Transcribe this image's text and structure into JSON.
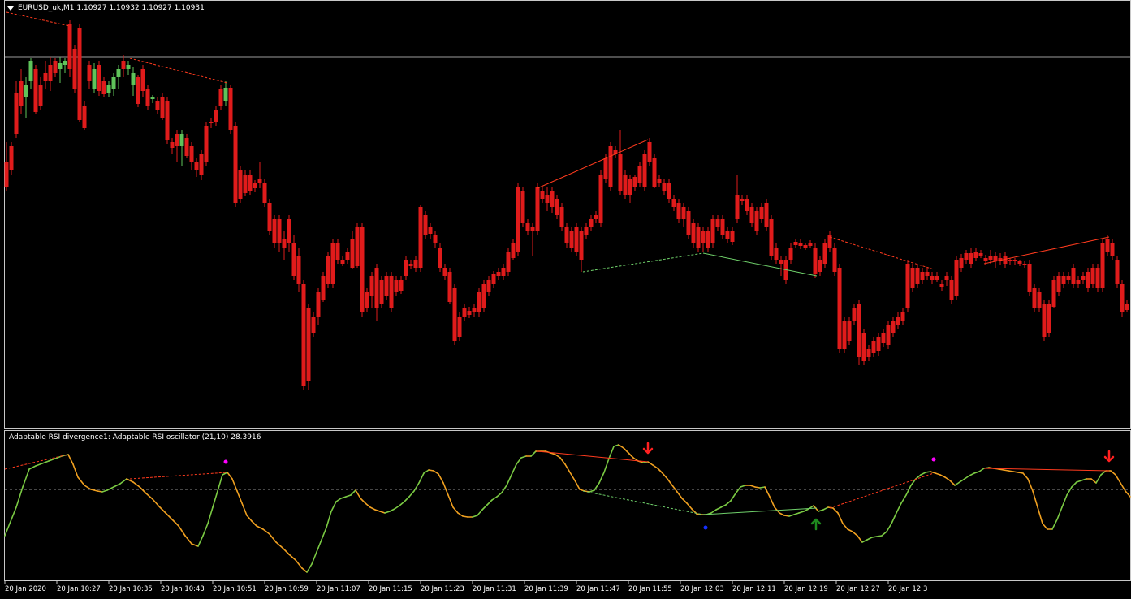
{
  "price_pane": {
    "symbol_label": "EURUSD_uk,M1  1.10927 1.10932 1.10927 1.10931",
    "menu_icon": "triangle-down-icon",
    "colors": {
      "bull": "#5fc35a",
      "bear": "#e01b1b",
      "wick": "#9a9a9a",
      "background": "#000000",
      "divergence_bear": "#ff3b1e",
      "divergence_bull": "#6fd06a"
    }
  },
  "oscillator_pane": {
    "label": "Adaptable RSI divergence1: Adaptable RSI oscillator (21,10) 28.3916",
    "colors": {
      "rising": "#7ac943",
      "falling": "#f0a020",
      "level": "#bdbdbd",
      "arrow_down": "#ff2020",
      "arrow_up": "#1e8a1e",
      "dot_magenta": "#ff00ff",
      "dot_blue": "#1530ff"
    },
    "markers": [
      {
        "type": "arrow-down-icon",
        "label": "bearish divergence arrow"
      },
      {
        "type": "arrow-up-icon",
        "label": "bullish divergence arrow"
      },
      {
        "type": "arrow-down-icon",
        "label": "bearish divergence arrow"
      }
    ]
  },
  "time_axis": {
    "labels": [
      "20 Jan 2020",
      "20 Jan 10:27",
      "20 Jan 10:35",
      "20 Jan 10:43",
      "20 Jan 10:51",
      "20 Jan 10:59",
      "20 Jan 11:07",
      "20 Jan 11:15",
      "20 Jan 11:23",
      "20 Jan 11:31",
      "20 Jan 11:39",
      "20 Jan 11:47",
      "20 Jan 11:55",
      "20 Jan 12:03",
      "20 Jan 12:11",
      "20 Jan 12:19",
      "20 Jan 12:27",
      "20 Jan 12:3"
    ]
  }
}
